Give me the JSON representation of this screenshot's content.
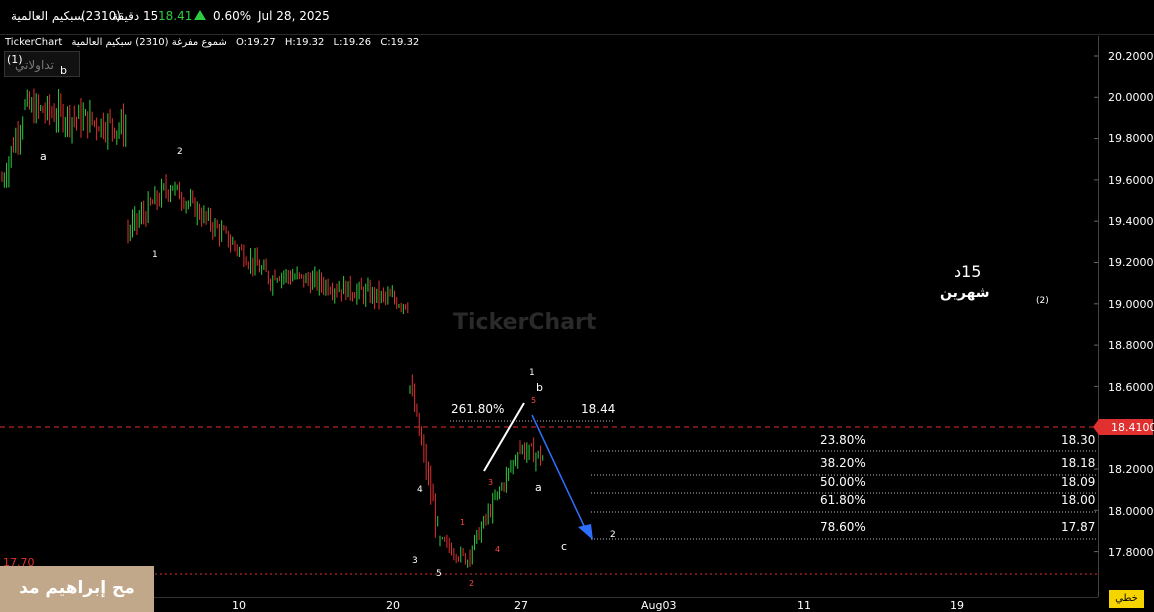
{
  "header": {
    "symbol_name": "سبكيم العالمية",
    "symbol_code": "(2310)",
    "interval": "15 دقيقة",
    "last_price": "18.41",
    "change_pct": "0.60%",
    "date": "Jul 28, 2025",
    "colors": {
      "up": "#2ecc40"
    }
  },
  "info_line": {
    "brand": "TickerChart",
    "description": "شموع مفرغة (2310) سبكيم العالمية",
    "open": "O:19.27",
    "high": "H:19.32",
    "low": "L:19.26",
    "close": "C:19.32"
  },
  "watermark_box": {
    "label": "تداولاتي",
    "marker": "(1)"
  },
  "watermark_center": "TickerChart",
  "timeframe_label": {
    "main": "15د",
    "sub": "شهرين"
  },
  "y_axis": {
    "ticks": [
      "20.2000",
      "20.0000",
      "19.8000",
      "19.6000",
      "19.4000",
      "19.2000",
      "19.0000",
      "18.8000",
      "18.6000",
      "18.4000",
      "18.2000",
      "18.0000",
      "17.8000"
    ]
  },
  "x_axis": {
    "ticks": [
      "10",
      "20",
      "27",
      "Aug03",
      "11",
      "19"
    ]
  },
  "current_price_badge": "18.4100",
  "left_price_label": "17.70",
  "mode_badge": "خطي",
  "author_label": "مح إبراهيم مد",
  "fib_extension": {
    "pct": "261.80%",
    "value": "18.44"
  },
  "fib_levels": [
    {
      "pct": "23.80%",
      "value": "18.30"
    },
    {
      "pct": "38.20%",
      "value": "18.18"
    },
    {
      "pct": "50.00%",
      "value": "18.09"
    },
    {
      "pct": "61.80%",
      "value": "18.00"
    },
    {
      "pct": "78.60%",
      "value": "17.87"
    }
  ],
  "wave_labels": {
    "a1": "a",
    "b1": "b",
    "w2a": "2",
    "w1a": "1",
    "w3": "3",
    "w4": "4",
    "w5": "5",
    "w1b": "1",
    "bb": "b",
    "a2": "a",
    "c": "c",
    "w2b": "2",
    "paren2": "(2)",
    "r1": "1",
    "r2": "2",
    "r3": "3",
    "r4": "4",
    "r5": "5"
  },
  "colors": {
    "bull": "#2ecc40",
    "bear": "#e03030",
    "fib_line": "#bbbbbb",
    "arrow": "#2f6fff",
    "price_line": "#e03030"
  }
}
